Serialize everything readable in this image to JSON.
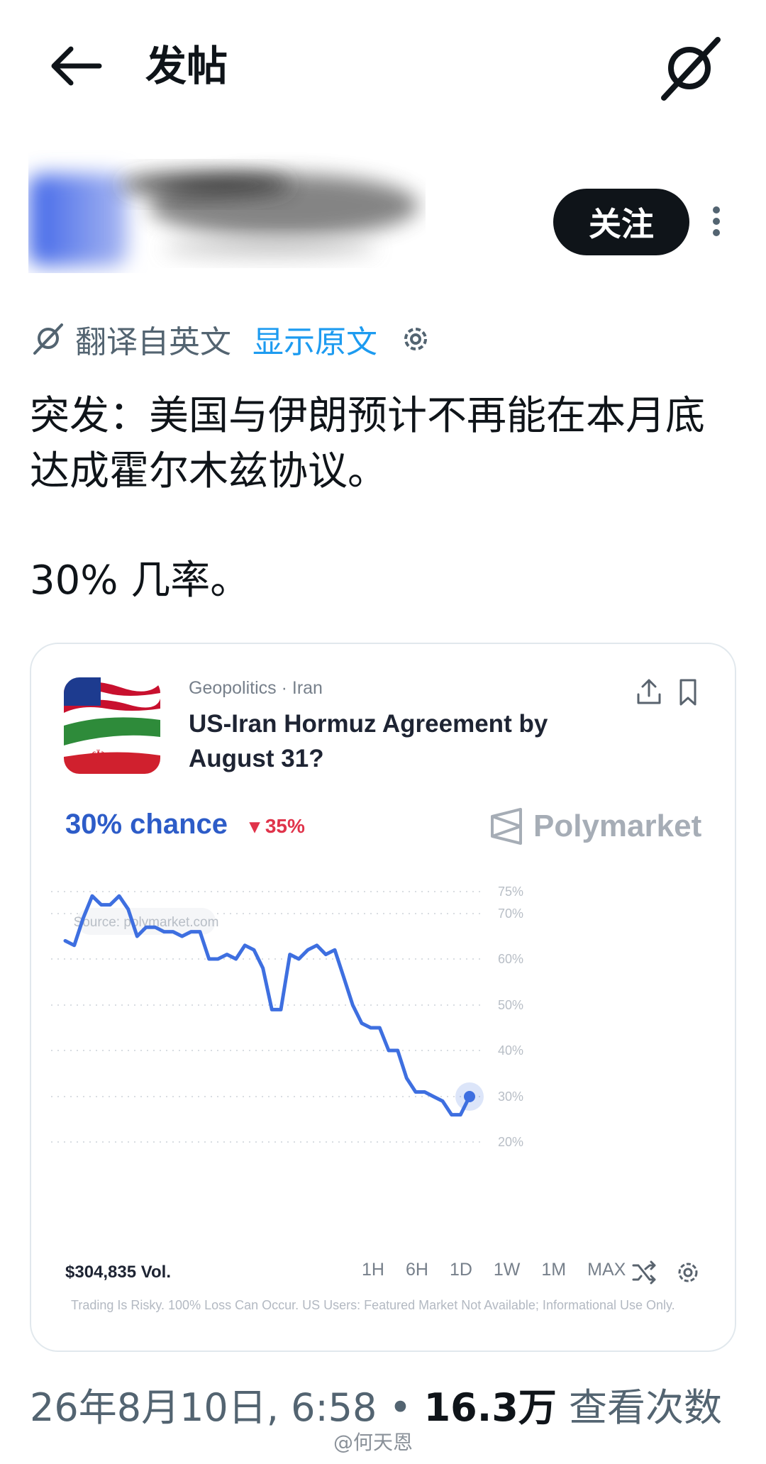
{
  "header": {
    "title": "发帖",
    "back_icon": "arrow-left-icon",
    "grok_icon": "grok-icon"
  },
  "author": {
    "follow_label": "关注"
  },
  "translation": {
    "label": "翻译自英文",
    "show_original": "显示原文"
  },
  "post": {
    "line1": "突发：美国与伊朗预计不再能在本月底达成霍尔木兹协议。",
    "line2": "30% 几率。"
  },
  "card": {
    "category": "Geopolitics · Iran",
    "question": "US-Iran Hormuz Agreement by August 31?",
    "chance": "30% chance",
    "delta": "▾ 35%",
    "brand": "Polymarket",
    "source": "Source: polymarket.com",
    "volume": "$304,835 Vol.",
    "ranges": [
      "1H",
      "6H",
      "1D",
      "1W",
      "1M",
      "MAX"
    ],
    "disclaimer": "Trading Is Risky. 100% Loss Can Occur. US Users: Featured Market Not Available; Informational Use Only.",
    "colors": {
      "line": "#3e6fe0",
      "chance": "#2d5cc8",
      "down": "#e0334a"
    }
  },
  "chart_data": {
    "type": "line",
    "ylim": [
      20,
      75
    ],
    "y_ticks": [
      {
        "value": 75,
        "label": "75%"
      },
      {
        "value": 70,
        "label": "70%"
      },
      {
        "value": 60,
        "label": "60%"
      },
      {
        "value": 50,
        "label": "50%"
      },
      {
        "value": 40,
        "label": "40%"
      },
      {
        "value": 30,
        "label": "30%"
      },
      {
        "value": 20,
        "label": "20%"
      }
    ],
    "grid": "dotted horizontal",
    "values": [
      64,
      63,
      69,
      74,
      72,
      72,
      74,
      71,
      65,
      67,
      67,
      66,
      66,
      65,
      66,
      66,
      60,
      60,
      61,
      60,
      63,
      62,
      58,
      49,
      49,
      61,
      60,
      62,
      63,
      61,
      62,
      56,
      50,
      46,
      45,
      45,
      40,
      40,
      34,
      31,
      31,
      30,
      29,
      26,
      26,
      30
    ],
    "last_value": 30
  },
  "footer": {
    "datetime": "26年8月10日, 6:58",
    "views_count": "16.3万",
    "views_label": "查看次数",
    "watermark": "@何天恩"
  }
}
